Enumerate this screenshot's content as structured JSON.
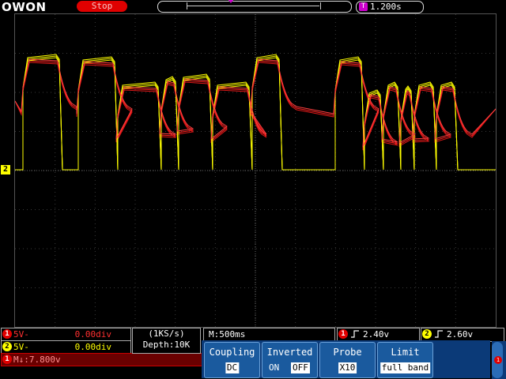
{
  "header": {
    "brand": "OWON",
    "run_state": "Stop",
    "time_icon": "T",
    "trigger_time": "1.200s"
  },
  "colors": {
    "ch1": "#ff2020",
    "ch2": "#ffff00",
    "accent_menu": "#1a5a9e"
  },
  "screen": {
    "ch2_marker": "2"
  },
  "channels": {
    "ch1": {
      "badge": "1",
      "scale": "5V-",
      "position": "0.00div"
    },
    "ch2": {
      "badge": "2",
      "scale": "5V-",
      "position": "0.00div"
    }
  },
  "math": {
    "badge": "1",
    "label": "M↓:7.800v"
  },
  "acquisition": {
    "rate": "(1KS/s)",
    "depth": "Depth:10K"
  },
  "timebase": {
    "label": "M:500ms"
  },
  "triggers": [
    {
      "badge": "1",
      "level": "2.40v"
    },
    {
      "badge": "2",
      "level": "2.60v"
    }
  ],
  "menu": {
    "coupling": {
      "title": "Coupling",
      "value": "DC"
    },
    "inverted": {
      "title": "Inverted",
      "on": "ON",
      "off": "OFF"
    },
    "probe": {
      "title": "Probe",
      "value": "X10"
    },
    "limit": {
      "title": "Limit",
      "value": "full band"
    }
  },
  "side": {
    "icon": "1"
  }
}
